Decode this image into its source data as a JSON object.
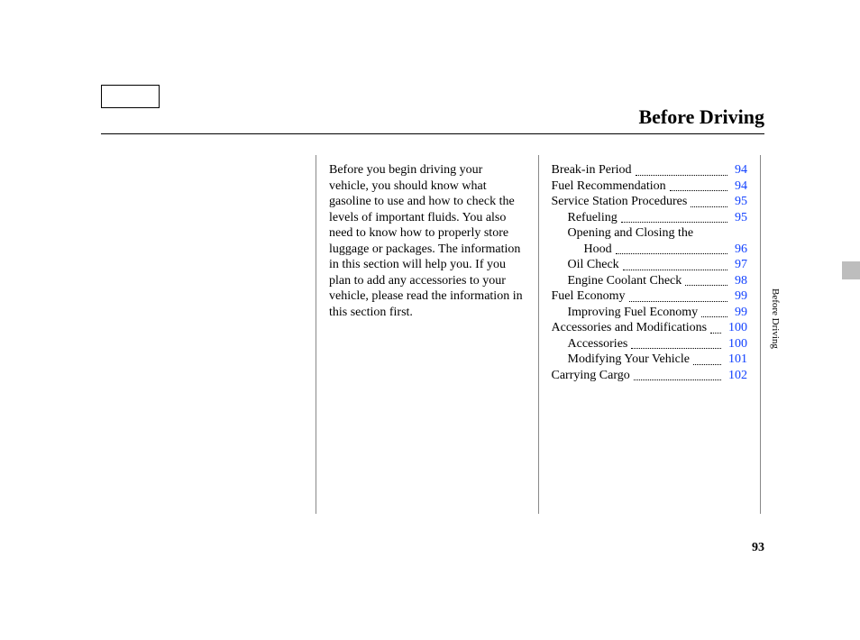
{
  "heading": "Before Driving",
  "intro": "Before you begin driving your vehicle, you should know what gasoline to use and how to check the levels of important fluids. You also need to know how to properly store luggage or packages. The information in this section will help you. If you plan to add any accessories to your vehicle, please read the information in this section first.",
  "side_label": "Before Driving",
  "page_number": "93",
  "toc": [
    {
      "label": "Break-in Period",
      "page": "94",
      "indent": 0
    },
    {
      "label": "Fuel Recommendation",
      "page": "94",
      "indent": 0
    },
    {
      "label": "Service Station Procedures",
      "page": "95",
      "indent": 0
    },
    {
      "label": "Refueling",
      "page": "95",
      "indent": 1
    },
    {
      "label": "Opening and Closing the",
      "page": "",
      "indent": 1
    },
    {
      "label": "Hood",
      "page": "96",
      "indent": 2
    },
    {
      "label": "Oil Check",
      "page": "97",
      "indent": 1
    },
    {
      "label": "Engine Coolant Check",
      "page": "98",
      "indent": 1
    },
    {
      "label": "Fuel Economy",
      "page": "99",
      "indent": 0
    },
    {
      "label": "Improving Fuel Economy",
      "page": "99",
      "indent": 1
    },
    {
      "label": "Accessories and Modifications",
      "page": "100",
      "indent": 0
    },
    {
      "label": "Accessories",
      "page": "100",
      "indent": 1
    },
    {
      "label": "Modifying Your Vehicle",
      "page": "101",
      "indent": 1
    },
    {
      "label": "Carrying Cargo",
      "page": "102",
      "indent": 0
    }
  ]
}
